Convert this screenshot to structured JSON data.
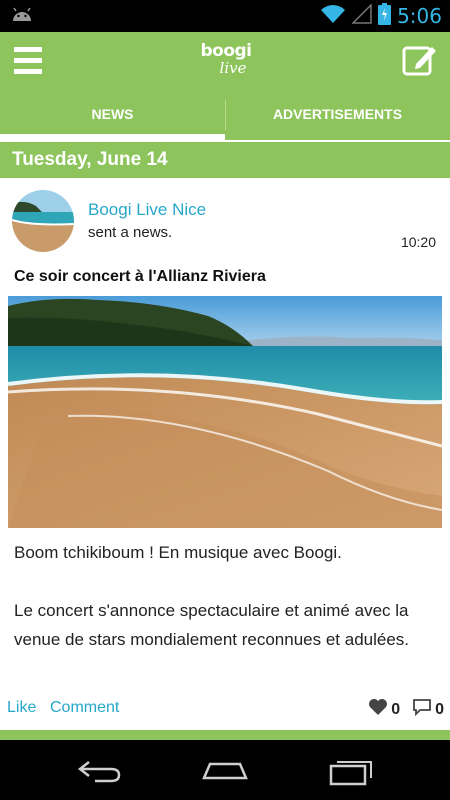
{
  "status_bar": {
    "time": "5:06"
  },
  "app_bar": {
    "logo_line1": "boogi",
    "logo_line2": "live",
    "menu_icon": "hamburger-menu-icon",
    "compose_icon": "edit-icon"
  },
  "tabs": [
    {
      "label": "NEWS",
      "active": true
    },
    {
      "label": "ADVERTISEMENTS",
      "active": false
    }
  ],
  "feed": {
    "date_header": "Tuesday, June 14",
    "post": {
      "author": "Boogi Live Nice",
      "action": "sent a news.",
      "time": "10:20",
      "title": "Ce soir concert à l'Allianz Riviera",
      "paragraphs": [
        "Boom tchikiboum ! En musique avec Boogi.",
        "Le concert s'annonce spectaculaire et animé avec la venue de stars mondialement reconnues et adulées."
      ],
      "like_label": "Like",
      "comment_label": "Comment",
      "likes_count": "0",
      "comments_count": "0"
    }
  },
  "colors": {
    "brand_green": "#8dc45b",
    "link_blue": "#27a8c9",
    "status_blue": "#34b5e5"
  }
}
